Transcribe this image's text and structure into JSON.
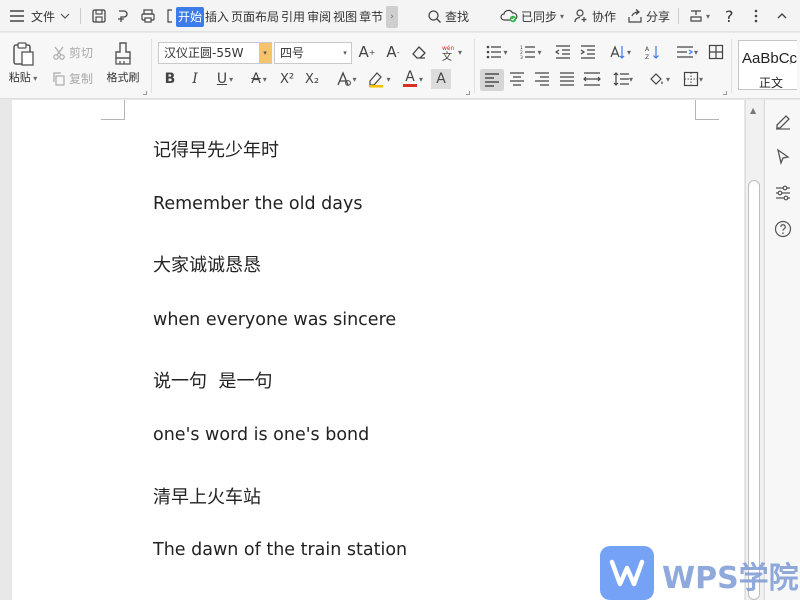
{
  "menubar": {
    "file_label": "文件",
    "tabs": [
      "开始",
      "插入",
      "页面布局",
      "引用",
      "审阅",
      "视图",
      "章节"
    ],
    "search_label": "查找",
    "sync_label": "已同步",
    "collab_label": "协作",
    "share_label": "分享",
    "help_label": "?"
  },
  "ribbon": {
    "paste_label": "粘贴",
    "cut_label": "剪切",
    "copy_label": "复制",
    "format_painter_label": "格式刷",
    "font_name": "汉仪正圆-55W",
    "font_size": "四号",
    "bold": "B",
    "italic": "I",
    "underline": "U",
    "font_color": "A",
    "char_shade": "A",
    "superscript": "X²",
    "subscript": "X₂",
    "style_sample": "AaBbCcD",
    "style_name": "正文"
  },
  "document": {
    "paragraphs": [
      "记得早先少年时",
      "Remember the old days",
      "大家诚诚恳恳",
      "when everyone was sincere",
      "说一句  是一句",
      "one's word is one's bond",
      "清早上火车站",
      "The dawn of the train station"
    ]
  },
  "watermark": {
    "text": "WPS学院"
  },
  "colors": {
    "accent": "#3b7bea",
    "font_color_bar": "#d93025",
    "highlight_bar": "#f2c200",
    "watermark": "#6f9ef5"
  }
}
